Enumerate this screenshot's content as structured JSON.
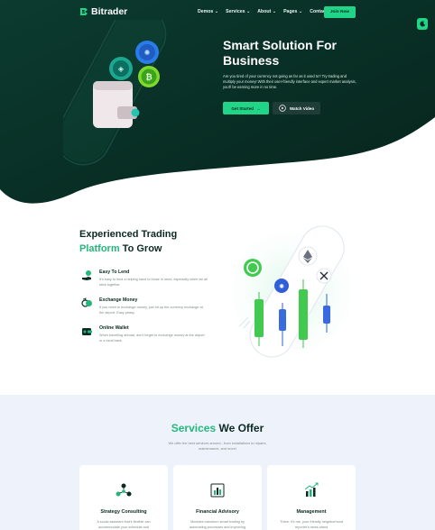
{
  "brand": {
    "name": "Bitrader",
    "accent": "#21d588",
    "dark": "#0b2a22"
  },
  "nav": {
    "items": [
      "Demos",
      "Services",
      "About",
      "Pages",
      "Contact Us"
    ],
    "has_dropdown": [
      true,
      true,
      true,
      true,
      false
    ],
    "join_label": "Join Now",
    "theme_toggle_icon": "moon-icon"
  },
  "hero": {
    "title": "Smart Solution For Business",
    "description": "Are you tired of your currency not going as far as it used to? Try trading and multiply your money! With their user-friendly interface and expert market analysis, you'll be earning more in no time.",
    "primary_button": "Get Started",
    "secondary_button": "Watch Video"
  },
  "trading": {
    "title_line1": "Experienced Trading",
    "title_accent": "Platform",
    "title_rest": " To Grow",
    "features": [
      {
        "icon": "hand-coin-icon",
        "title": "Easy To Lend",
        "desc": "It's easy to lend a helping hand to those in need, especially when we all stick together."
      },
      {
        "icon": "exchange-icon",
        "title": "Exchange Money",
        "desc": "If you need to exchange money, just hit up the currency exchange at the airport. Easy peasy."
      },
      {
        "icon": "wallet-icon",
        "title": "Online Wallet",
        "desc": "When travelling abroad, don't forget to exchange money at the airport or a local bank."
      }
    ]
  },
  "services": {
    "title_accent": "Services",
    "title_rest": " We Offer",
    "description": "We offer the best services around - from installations to repairs, maintenance, and more!",
    "cards": [
      {
        "icon": "strategy-icon",
        "title": "Strategy Consulting",
        "desc": "A social assistant that's flexible can accommodate your schedule and"
      },
      {
        "icon": "chart-icon",
        "title": "Financial Advisory",
        "desc": "Modules transform smart trading by automating processes and improving"
      },
      {
        "icon": "growth-chart-icon",
        "title": "Management",
        "desc": "There, it's me, your friendly neighborhood reporter's news stand"
      }
    ]
  }
}
